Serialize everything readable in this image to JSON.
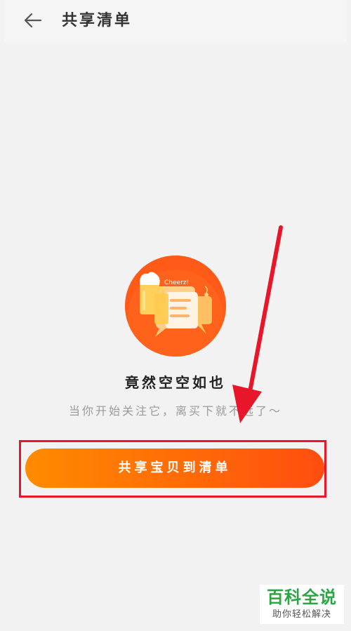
{
  "header": {
    "back_icon": "arrow-left-icon",
    "title": "共享清单"
  },
  "empty_state": {
    "illustration_icon": "cheers-chat-illustration-icon",
    "illustration_text": "Cheerz!",
    "title": "竟然空空如也",
    "subtitle": "当你开始关注它，离买下就不远了～"
  },
  "actions": {
    "share_button_label": "共享宝贝到清单"
  },
  "annotations": {
    "highlight_color": "#e8162b",
    "arrow_color": "#e8162b"
  },
  "watermark": {
    "title": "百科全说",
    "subtitle": "助你轻松解决"
  },
  "colors": {
    "accent": "#ff6a07",
    "background": "#f2f2f2"
  }
}
